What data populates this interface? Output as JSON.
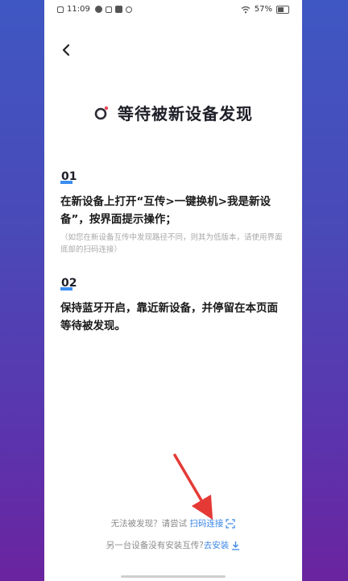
{
  "status_bar": {
    "time": "11:09",
    "battery": "57%"
  },
  "title": "等待被新设备发现",
  "steps": [
    {
      "num": "01",
      "text": "在新设备上打开“互传>一键换机>我是新设备”，按界面提示操作；",
      "note": "（如您在新设备互传中发现路径不同，则其为低版本，请使用界面底部的扫码连接）"
    },
    {
      "num": "02",
      "text": "保持蓝牙开启，靠近新设备，并停留在本页面等待被发现。"
    }
  ],
  "bottom": {
    "hint1": "无法被发现？请尝试 ",
    "scan_link": "扫码连接",
    "hint2": "另一台设备没有安装互传?",
    "install_link": "去安装"
  },
  "colors": {
    "accent": "#3a86e6",
    "logo_red": "#e8475a",
    "arrow": "#e53935"
  }
}
